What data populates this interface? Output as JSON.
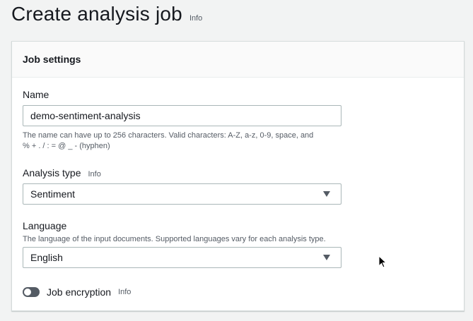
{
  "page": {
    "title": "Create analysis job",
    "info": "Info"
  },
  "job_settings": {
    "title": "Job settings",
    "name": {
      "label": "Name",
      "value": "demo-sentiment-analysis",
      "hint_line1": "The name can have up to 256 characters. Valid characters: A-Z, a-z, 0-9, space, and",
      "hint_line2": "% + . / : = @ _ - (hyphen)"
    },
    "analysis_type": {
      "label": "Analysis type",
      "info": "Info",
      "selected": "Sentiment"
    },
    "language": {
      "label": "Language",
      "description": "The language of the input documents. Supported languages vary for each analysis type.",
      "selected": "English"
    },
    "encryption": {
      "label": "Job encryption",
      "info": "Info",
      "enabled": false
    }
  },
  "icons": {
    "select_caret": "caret-down-icon",
    "pointer": "mouse-pointer-icon"
  }
}
